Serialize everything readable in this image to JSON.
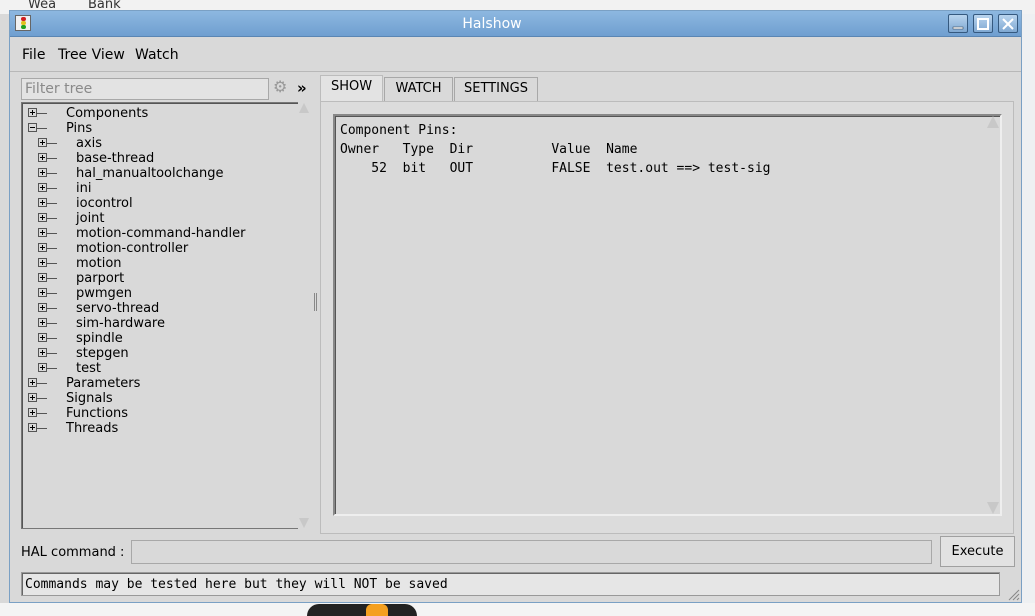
{
  "background": {
    "top_items": [
      "Wea",
      "Bank"
    ]
  },
  "window": {
    "title": "Halshow",
    "menu": [
      "File",
      "Tree View",
      "Watch"
    ]
  },
  "tree": {
    "filter_placeholder": "Filter tree",
    "expand_symbol": "»",
    "nodes": [
      {
        "label": "Components",
        "level": 0,
        "state": "collapsed"
      },
      {
        "label": "Pins",
        "level": 0,
        "state": "expanded"
      },
      {
        "label": "axis",
        "level": 1,
        "state": "collapsed"
      },
      {
        "label": "base-thread",
        "level": 1,
        "state": "collapsed"
      },
      {
        "label": "hal_manualtoolchange",
        "level": 1,
        "state": "collapsed"
      },
      {
        "label": "ini",
        "level": 1,
        "state": "collapsed"
      },
      {
        "label": "iocontrol",
        "level": 1,
        "state": "collapsed"
      },
      {
        "label": "joint",
        "level": 1,
        "state": "collapsed"
      },
      {
        "label": "motion-command-handler",
        "level": 1,
        "state": "collapsed"
      },
      {
        "label": "motion-controller",
        "level": 1,
        "state": "collapsed"
      },
      {
        "label": "motion",
        "level": 1,
        "state": "collapsed"
      },
      {
        "label": "parport",
        "level": 1,
        "state": "collapsed"
      },
      {
        "label": "pwmgen",
        "level": 1,
        "state": "collapsed"
      },
      {
        "label": "servo-thread",
        "level": 1,
        "state": "collapsed"
      },
      {
        "label": "sim-hardware",
        "level": 1,
        "state": "collapsed"
      },
      {
        "label": "spindle",
        "level": 1,
        "state": "collapsed"
      },
      {
        "label": "stepgen",
        "level": 1,
        "state": "collapsed"
      },
      {
        "label": "test",
        "level": 1,
        "state": "collapsed"
      },
      {
        "label": "Parameters",
        "level": 0,
        "state": "collapsed"
      },
      {
        "label": "Signals",
        "level": 0,
        "state": "collapsed"
      },
      {
        "label": "Functions",
        "level": 0,
        "state": "collapsed"
      },
      {
        "label": "Threads",
        "level": 0,
        "state": "collapsed"
      }
    ]
  },
  "tabs": [
    {
      "label": "SHOW",
      "active": true
    },
    {
      "label": "WATCH",
      "active": false
    },
    {
      "label": "SETTINGS",
      "active": false
    }
  ],
  "show": {
    "heading": "Component Pins:",
    "columns": [
      "Owner",
      "Type",
      "Dir",
      "Value",
      "Name"
    ],
    "rows": [
      {
        "owner": "52",
        "type": "bit",
        "dir": "OUT",
        "value": "FALSE",
        "name": "test.out ==> test-sig"
      }
    ]
  },
  "command": {
    "label": "HAL command :",
    "value": "",
    "execute_label": "Execute",
    "status": "Commands may be tested here but they will NOT be saved"
  },
  "colors": {
    "titlebar": "#7fa8d2",
    "window_bg": "#d9d9d9"
  }
}
